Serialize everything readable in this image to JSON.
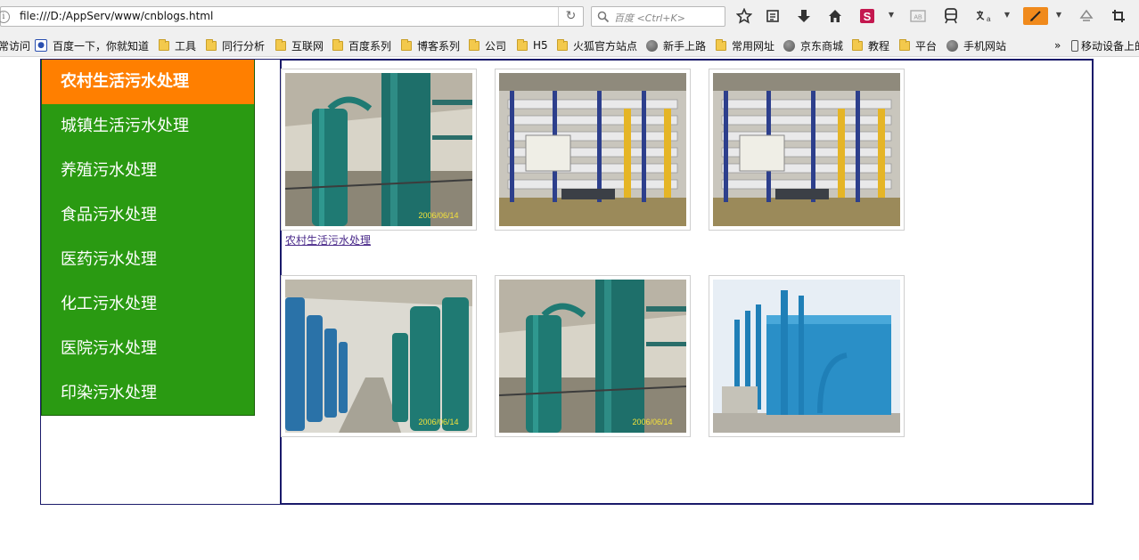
{
  "browser": {
    "url": "file:///D:/AppServ/www/cnblogs.html",
    "search_placeholder": "百度 <Ctrl+K>",
    "toolbar_icons": [
      "star-icon",
      "reading-list-icon",
      "download-icon",
      "home-icon",
      "sogou-icon",
      "screenshot-icon",
      "train-icon",
      "translate-icon",
      "pen-icon",
      "sync-icon",
      "crop-icon"
    ],
    "bookmarks": [
      {
        "label": "常访问",
        "icon": "none"
      },
      {
        "label": "百度一下，你就知道",
        "icon": "paw-icon"
      },
      {
        "label": "工具",
        "icon": "folder-icon"
      },
      {
        "label": "同行分析",
        "icon": "folder-icon"
      },
      {
        "label": "互联网",
        "icon": "folder-icon"
      },
      {
        "label": "百度系列",
        "icon": "folder-icon"
      },
      {
        "label": "博客系列",
        "icon": "folder-icon"
      },
      {
        "label": "公司",
        "icon": "folder-icon"
      },
      {
        "label": "H5",
        "icon": "folder-icon"
      },
      {
        "label": "火狐官方站点",
        "icon": "folder-icon"
      },
      {
        "label": "新手上路",
        "icon": "globe-icon"
      },
      {
        "label": "常用网址",
        "icon": "folder-icon"
      },
      {
        "label": "京东商城",
        "icon": "globe-icon"
      },
      {
        "label": "教程",
        "icon": "folder-icon"
      },
      {
        "label": "平台",
        "icon": "folder-icon"
      },
      {
        "label": "手机网站",
        "icon": "globe-icon"
      }
    ],
    "overflow": "»",
    "mobile_bookmarks": "移动设备上的"
  },
  "menu": {
    "items": [
      {
        "label": "农村生活污水处理",
        "active": true
      },
      {
        "label": "城镇生活污水处理",
        "active": false
      },
      {
        "label": "养殖污水处理",
        "active": false
      },
      {
        "label": "食品污水处理",
        "active": false
      },
      {
        "label": "医药污水处理",
        "active": false
      },
      {
        "label": "化工污水处理",
        "active": false
      },
      {
        "label": "医院污水处理",
        "active": false
      },
      {
        "label": "印染污水处理",
        "active": false
      }
    ],
    "active_color": "#ff7f00",
    "bg_color": "#2a9a12"
  },
  "gallery": {
    "caption": "农村生活污水处理",
    "date_stamp": "2006/06/14"
  }
}
